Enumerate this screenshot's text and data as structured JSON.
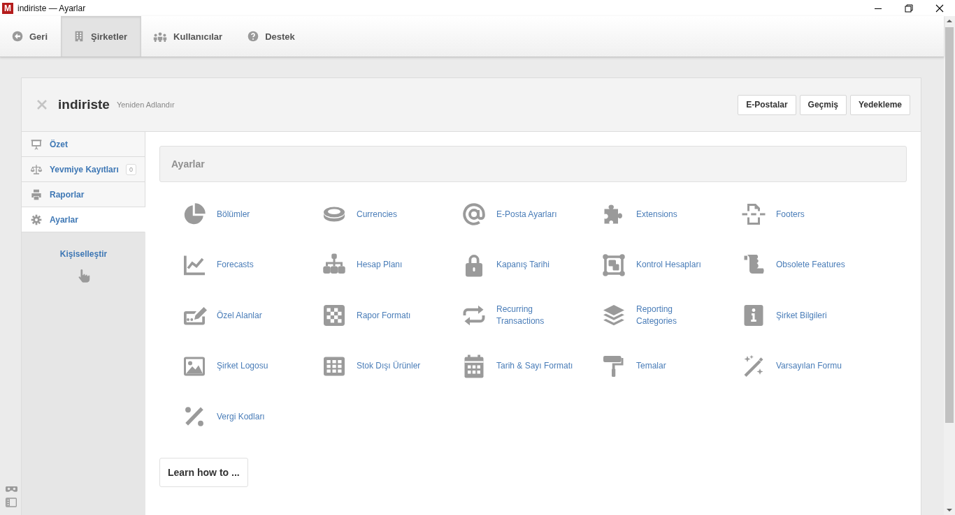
{
  "window": {
    "title": "indiriste — Ayarlar",
    "app_letter": "M"
  },
  "nav": [
    {
      "label": "Geri",
      "selected": false
    },
    {
      "label": "Şirketler",
      "selected": true
    },
    {
      "label": "Kullanıcılar",
      "selected": false
    },
    {
      "label": "Destek",
      "selected": false
    }
  ],
  "company": {
    "name": "indiriste",
    "rename_link": "Yeniden Adlandır",
    "buttons": [
      "E-Postalar",
      "Geçmiş",
      "Yedekleme"
    ]
  },
  "sidebar": {
    "items": [
      {
        "label": "Özet",
        "selected": false
      },
      {
        "label": "Yevmiye Kayıtları",
        "badge": "0",
        "selected": false
      },
      {
        "label": "Raporlar",
        "selected": false
      },
      {
        "label": "Ayarlar",
        "selected": true
      }
    ],
    "customize_link": "Kişiselleştir"
  },
  "panel": {
    "title": "Ayarlar",
    "items": [
      "Bölümler",
      "Currencies",
      "E-Posta Ayarları",
      "Extensions",
      "Footers",
      "Forecasts",
      "Hesap Planı",
      "Kapanış Tarihi",
      "Kontrol Hesapları",
      "Obsolete Features",
      "Özel Alanlar",
      "Rapor Formatı",
      "Recurring\nTransactions",
      "Reporting\nCategories",
      "Şirket Bilgileri",
      "Şirket Logosu",
      "Stok Dışı Ürünler",
      "Tarih & Sayı Formatı",
      "Temalar",
      "Varsayılan Formu",
      "Vergi Kodları"
    ],
    "learn_button": "Learn how to ..."
  }
}
